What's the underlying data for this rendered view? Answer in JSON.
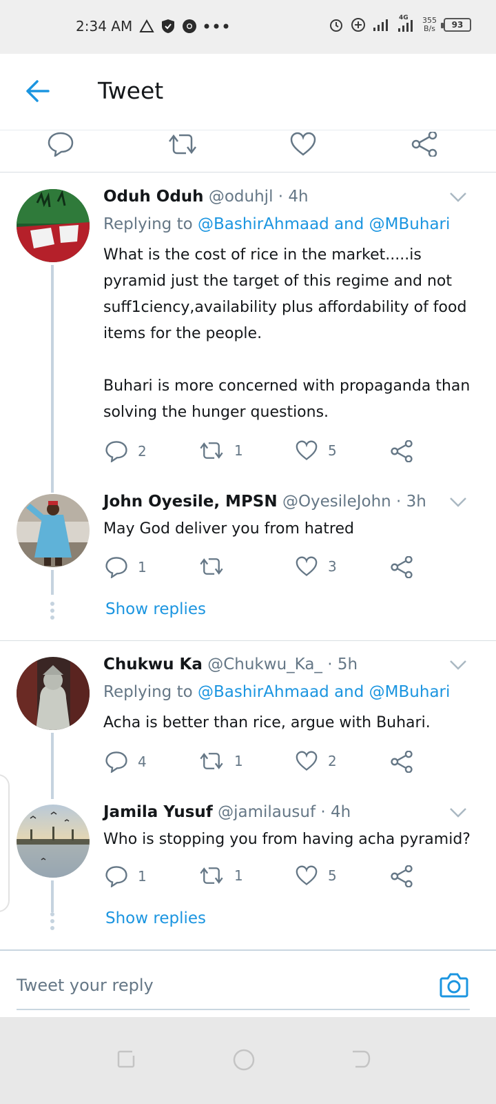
{
  "status_bar": {
    "time": "2:34 AM",
    "net_speed_value": "355",
    "net_speed_unit": "B/s",
    "signal_label": "4G",
    "battery": "93"
  },
  "header": {
    "title": "Tweet"
  },
  "tweets": [
    {
      "name": "Oduh Oduh",
      "meta": "@oduhjl · 4h",
      "replying_prefix": "Replying to ",
      "replying_to": "@BashirAhmaad and @MBuhari",
      "text": "What is the cost of rice in the market.....is pyramid just the target of this regime and not suff1ciency,availability plus affordability of food items for the people.\n\nBuhari is more concerned with propaganda than solving the hunger questions.",
      "replies": "2",
      "retweets": "1",
      "likes": "5"
    },
    {
      "name": "John Oyesile, MPSN",
      "meta": "@OyesileJohn · 3h",
      "text": "May God deliver you from hatred",
      "replies": "1",
      "retweets": "",
      "likes": "3",
      "show_replies": "Show replies"
    },
    {
      "name": "Chukwu Ka",
      "meta": "@Chukwu_Ka_ · 5h",
      "replying_prefix": "Replying to ",
      "replying_to": "@BashirAhmaad and @MBuhari",
      "text": "Acha is better than rice, argue with Buhari.",
      "replies": "4",
      "retweets": "1",
      "likes": "2"
    },
    {
      "name": "Jamila Yusuf",
      "meta": "@jamilausuf · 4h",
      "text": "Who is stopping you from having acha pyramid?",
      "replies": "1",
      "retweets": "1",
      "likes": "5",
      "show_replies": "Show replies"
    }
  ],
  "reply_bar": {
    "placeholder": "Tweet your reply"
  },
  "colors": {
    "accent": "#1b95e0",
    "secondary_text": "#657786",
    "divider": "#d8dee2"
  }
}
